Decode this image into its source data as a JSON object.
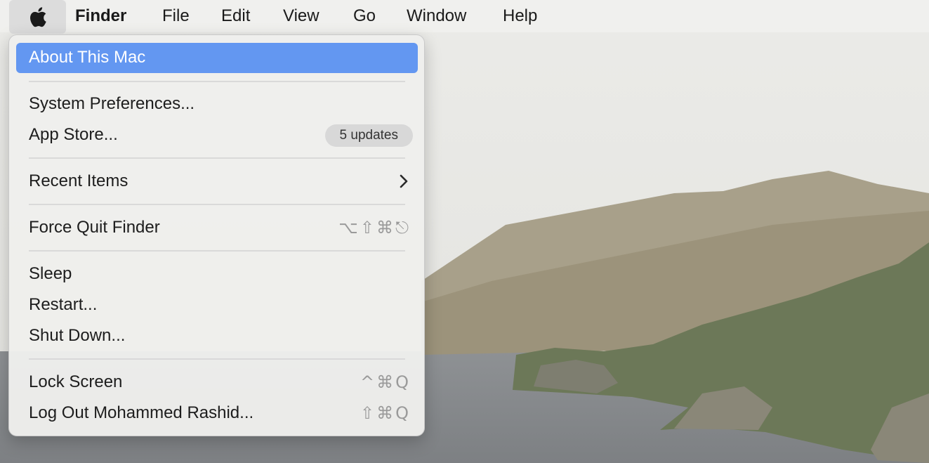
{
  "menubar": {
    "apple_icon": "apple-logo-icon",
    "items": [
      {
        "label": "Finder",
        "bold": true
      },
      {
        "label": "File"
      },
      {
        "label": "Edit"
      },
      {
        "label": "View"
      },
      {
        "label": "Go"
      },
      {
        "label": "Window"
      },
      {
        "label": "Help"
      }
    ]
  },
  "apple_menu": {
    "highlight_color": "#6397f1",
    "items": [
      {
        "label": "About This Mac",
        "highlighted": true
      },
      {
        "label": "System Preferences..."
      },
      {
        "label": "App Store...",
        "badge": "5 updates"
      },
      {
        "label": "Recent Items",
        "submenu_icon": "chevron-right-icon"
      },
      {
        "label": "Force Quit Finder",
        "shortcut": "⌥⇧⌘⎋"
      },
      {
        "label": "Sleep"
      },
      {
        "label": "Restart..."
      },
      {
        "label": "Shut Down..."
      },
      {
        "label": "Lock Screen",
        "shortcut": "^⌘Q"
      },
      {
        "label": "Log Out Mohammed Rashid...",
        "shortcut": "⇧⌘Q"
      }
    ]
  }
}
